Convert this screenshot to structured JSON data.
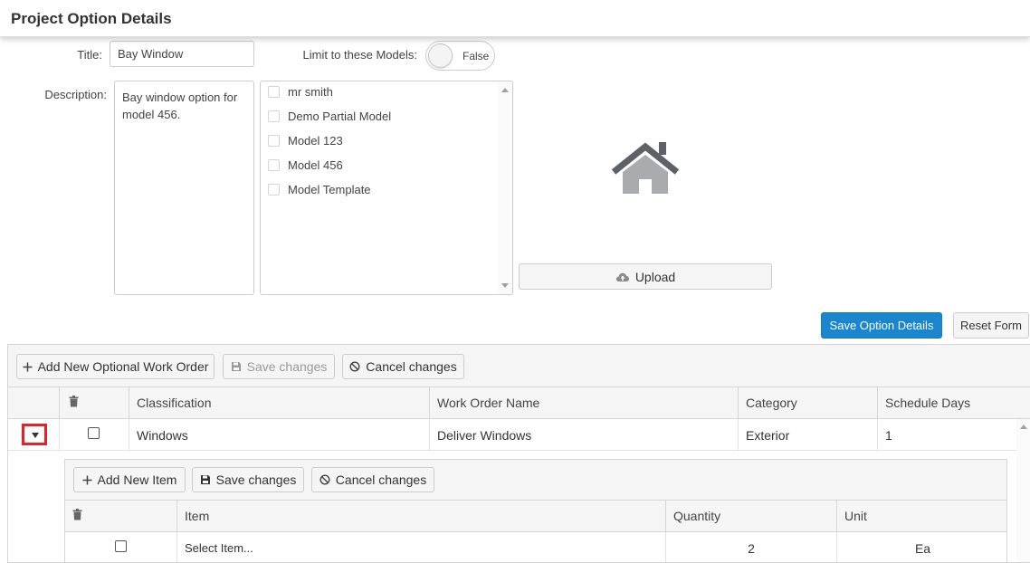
{
  "header": {
    "title": "Project Option Details"
  },
  "form": {
    "title_label": "Title:",
    "title_value": "Bay Window",
    "limit_label": "Limit to these Models:",
    "limit_toggle": "False",
    "description_label": "Description:",
    "description_value": "Bay window option for model 456.",
    "models": [
      {
        "label": "mr smith"
      },
      {
        "label": "Demo Partial Model"
      },
      {
        "label": "Model 123"
      },
      {
        "label": "Model 456"
      },
      {
        "label": "Model Template"
      }
    ],
    "upload_label": "Upload",
    "save_label": "Save Option Details",
    "reset_label": "Reset Form"
  },
  "grid": {
    "toolbar": {
      "add_label": "Add New Optional Work Order",
      "save_label": "Save changes",
      "cancel_label": "Cancel changes"
    },
    "columns": [
      "Classification",
      "Work Order Name",
      "Category",
      "Schedule Days"
    ],
    "rows": [
      {
        "classification": "Windows",
        "work_order_name": "Deliver Windows",
        "category": "Exterior",
        "schedule_days": "1"
      }
    ],
    "detail": {
      "toolbar": {
        "add_label": "Add New Item",
        "save_label": "Save changes",
        "cancel_label": "Cancel changes"
      },
      "columns": [
        "Item",
        "Quantity",
        "Unit"
      ],
      "rows": [
        {
          "item": "Select Item...",
          "quantity": "2",
          "unit": "Ea"
        }
      ]
    }
  },
  "colors": {
    "primary": "#1a86d0",
    "highlight_border": "#e0242a",
    "icon_gray": "#5e6168",
    "icon_light": "#a9abae"
  },
  "icons": [
    "house-icon",
    "cloud-upload-icon",
    "plus-icon",
    "floppy-disk-icon",
    "cancel-circle-icon",
    "trash-icon",
    "caret-down-icon"
  ]
}
